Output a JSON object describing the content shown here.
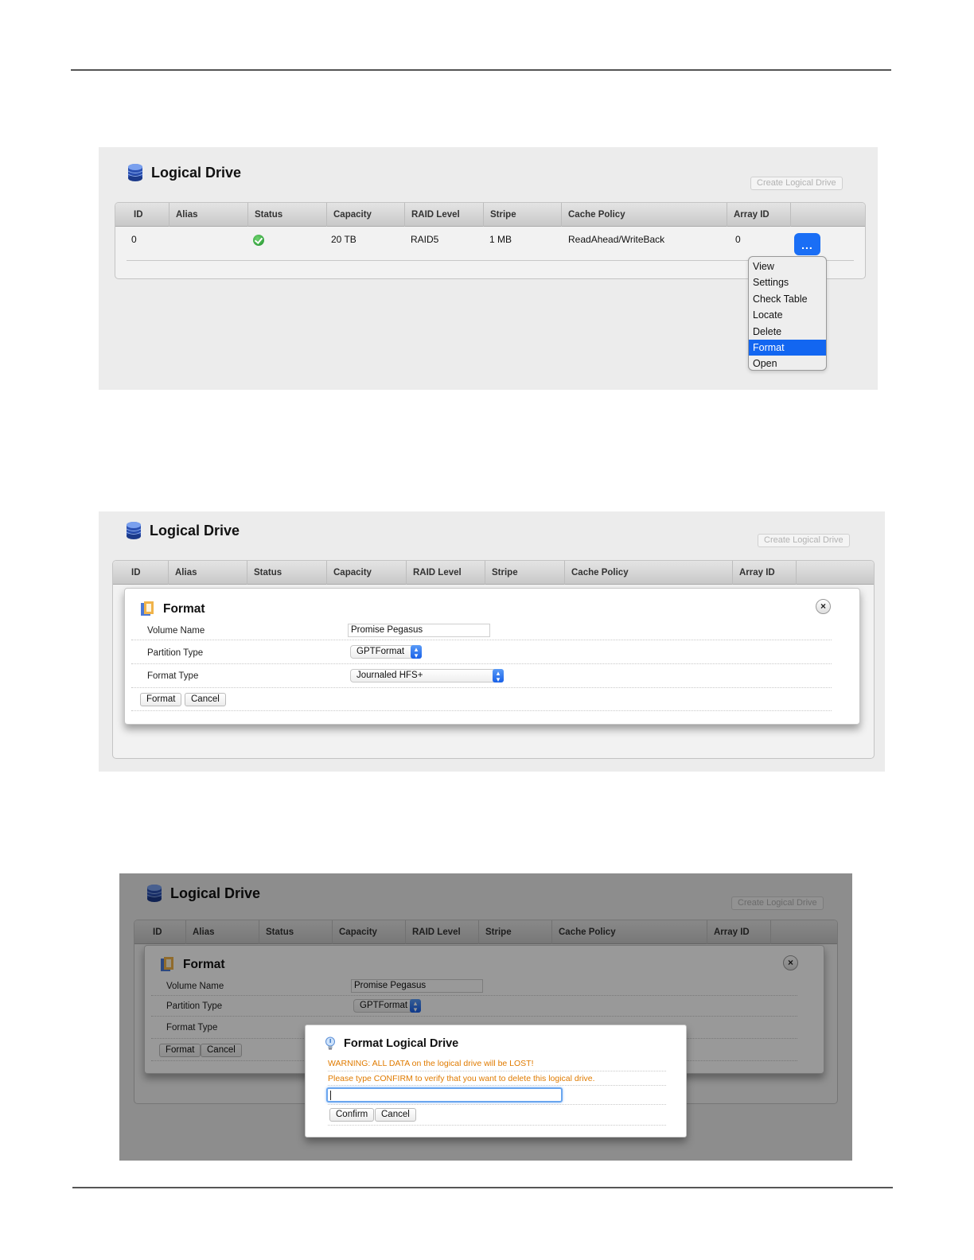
{
  "panel_title": "Logical Drive",
  "create_button": "Create Logical Drive",
  "columns": [
    "ID",
    "Alias",
    "Status",
    "Capacity",
    "RAID Level",
    "Stripe",
    "Cache Policy",
    "Array ID"
  ],
  "row": {
    "id": "0",
    "alias": "",
    "status": "OK",
    "capacity": "20 TB",
    "raid_level": "RAID5",
    "stripe": "1 MB",
    "cache_policy": "ReadAhead/WriteBack",
    "array_id": "0"
  },
  "more_button": "...",
  "menu": {
    "items": [
      "View",
      "Settings",
      "Check Table",
      "Locate",
      "Delete",
      "Format",
      "Open"
    ],
    "selected": "Format"
  },
  "format_dialog": {
    "title": "Format",
    "close": "×",
    "volume_name_label": "Volume Name",
    "volume_name_value": "Promise Pegasus",
    "partition_type_label": "Partition Type",
    "partition_type_value": "GPTFormat",
    "format_type_label": "Format Type",
    "format_type_value": "Journaled HFS+",
    "format_button": "Format",
    "cancel_button": "Cancel"
  },
  "confirm_dialog": {
    "title": "Format Logical Drive",
    "warning": "WARNING: ALL DATA on the logical drive will be LOST!",
    "instruction": "Please type CONFIRM to verify that you want to delete this logical drive.",
    "input_value": "",
    "confirm_button": "Confirm",
    "cancel_button": "Cancel"
  },
  "colors": {
    "accent_blue": "#1266f1",
    "warning_orange": "#e07b00",
    "status_green": "#2aa83a"
  }
}
